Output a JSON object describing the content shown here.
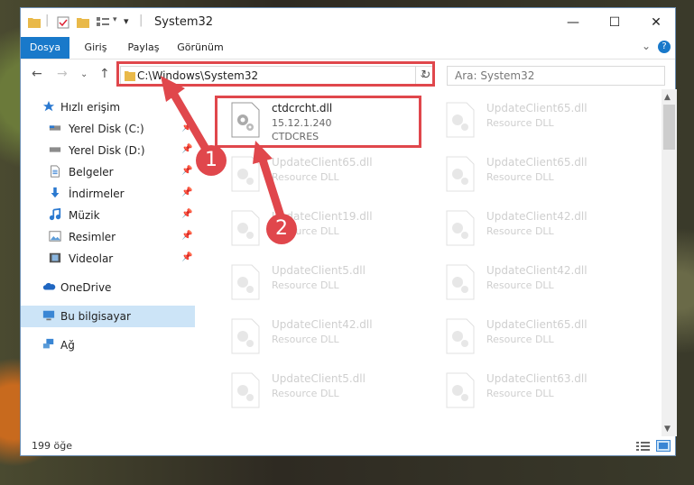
{
  "window": {
    "title": "System32",
    "controls": {
      "minimize": "—",
      "maximize": "☐",
      "close": "✕"
    }
  },
  "ribbon": {
    "tabs": [
      {
        "label": "Dosya"
      },
      {
        "label": "Giriş"
      },
      {
        "label": "Paylaş"
      },
      {
        "label": "Görünüm"
      }
    ],
    "expand": "⌄",
    "help": "?"
  },
  "address": {
    "path": "C:\\Windows\\System32",
    "dropdown": "⌄",
    "refresh": "↻"
  },
  "search": {
    "placeholder": "Ara: System32"
  },
  "nav": {
    "back": "←",
    "forward": "→",
    "recent": "⌄",
    "up": "↑"
  },
  "sidebar": {
    "items": [
      {
        "label": "Hızlı erişim",
        "icon": "star-icon"
      },
      {
        "label": "Yerel Disk (C:)",
        "icon": "drive-icon",
        "pinned": true
      },
      {
        "label": "Yerel Disk (D:)",
        "icon": "drive-icon",
        "pinned": true
      },
      {
        "label": "Belgeler",
        "icon": "document-icon",
        "pinned": true
      },
      {
        "label": "İndirmeler",
        "icon": "download-icon",
        "pinned": true
      },
      {
        "label": "Müzik",
        "icon": "music-icon",
        "pinned": true
      },
      {
        "label": "Resimler",
        "icon": "picture-icon",
        "pinned": true
      },
      {
        "label": "Videolar",
        "icon": "video-icon",
        "pinned": true
      },
      {
        "label": "OneDrive",
        "icon": "cloud-icon"
      },
      {
        "label": "Bu bilgisayar",
        "icon": "computer-icon",
        "selected": true
      },
      {
        "label": "Ağ",
        "icon": "network-icon"
      }
    ]
  },
  "files": [
    {
      "name": "ctdcrcht.dll",
      "line2": "15.12.1.240",
      "line3": "CTDCRES",
      "highlight": true
    },
    {
      "name": "UpdateClient65.dll",
      "line2": "Resource DLL"
    },
    {
      "name": "UpdateClient65.dll",
      "line2": "Resource DLL"
    },
    {
      "name": "UpdateClient65.dll",
      "line2": "Resource DLL"
    },
    {
      "name": "UpdateClient19.dll",
      "line2": "Resource DLL"
    },
    {
      "name": "UpdateClient42.dll",
      "line2": "Resource DLL"
    },
    {
      "name": "UpdateClient5.dll",
      "line2": "Resource DLL"
    },
    {
      "name": "UpdateClient42.dll",
      "line2": "Resource DLL"
    },
    {
      "name": "UpdateClient42.dll",
      "line2": "Resource DLL"
    },
    {
      "name": "UpdateClient65.dll",
      "line2": "Resource DLL"
    },
    {
      "name": "UpdateClient5.dll",
      "line2": "Resource DLL"
    },
    {
      "name": "UpdateClient63.dll",
      "line2": "Resource DLL"
    }
  ],
  "status": {
    "count": "199 öğe"
  },
  "annotations": {
    "step1": "1",
    "step2": "2",
    "color": "#e0474c"
  },
  "colors": {
    "accent": "#1979ca",
    "selected": "#cce4f7"
  }
}
